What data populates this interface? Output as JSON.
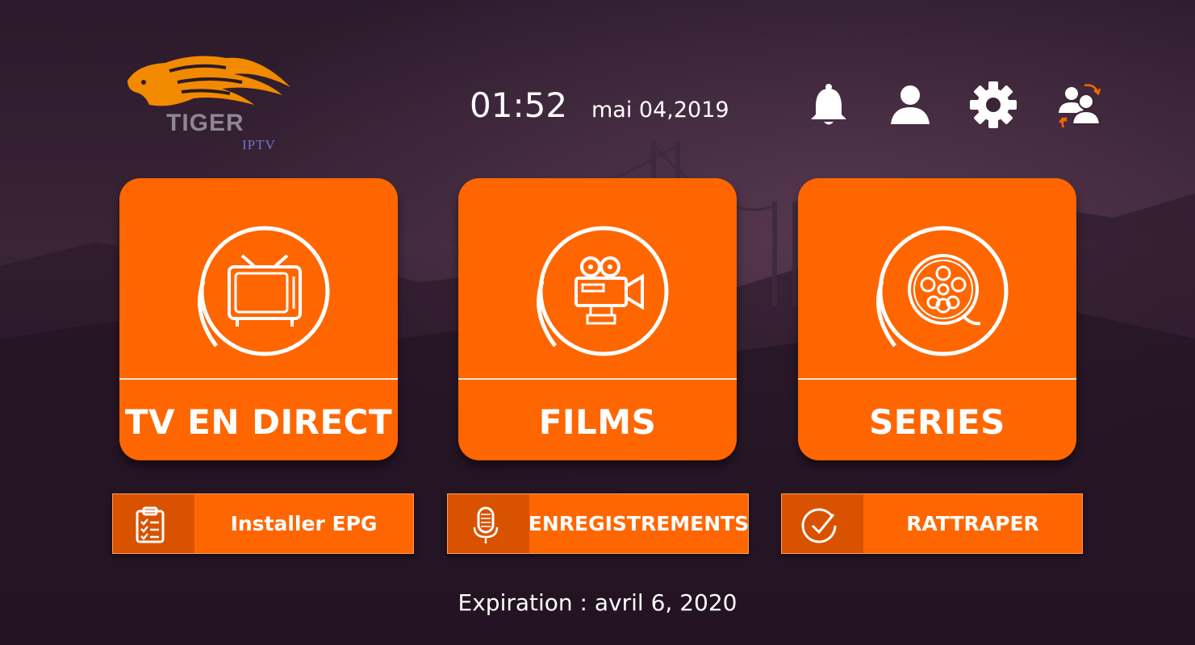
{
  "brand": {
    "name": "TIGER",
    "sub": "IPTV"
  },
  "header": {
    "time": "01:52",
    "date": "mai 04,2019"
  },
  "top_icons": [
    "bell-icon",
    "user-icon",
    "gear-icon",
    "switch-users-icon"
  ],
  "cards": [
    {
      "label": "TV EN DIRECT",
      "icon": "tv-icon"
    },
    {
      "label": "FILMS",
      "icon": "movie-camera-icon"
    },
    {
      "label": "SERIES",
      "icon": "film-reel-icon"
    }
  ],
  "buttons": [
    {
      "label": "Installer EPG",
      "icon": "clipboard-checklist-icon"
    },
    {
      "label": "ENREGISTREMENTS",
      "icon": "microphone-icon"
    },
    {
      "label": "RATTRAPER",
      "icon": "check-circle-icon"
    }
  ],
  "footer": {
    "expiration": "Expiration : avril 6, 2020"
  },
  "colors": {
    "accent": "#ff6600",
    "accent_dark": "#d95200",
    "background": "#2f1d2e"
  }
}
